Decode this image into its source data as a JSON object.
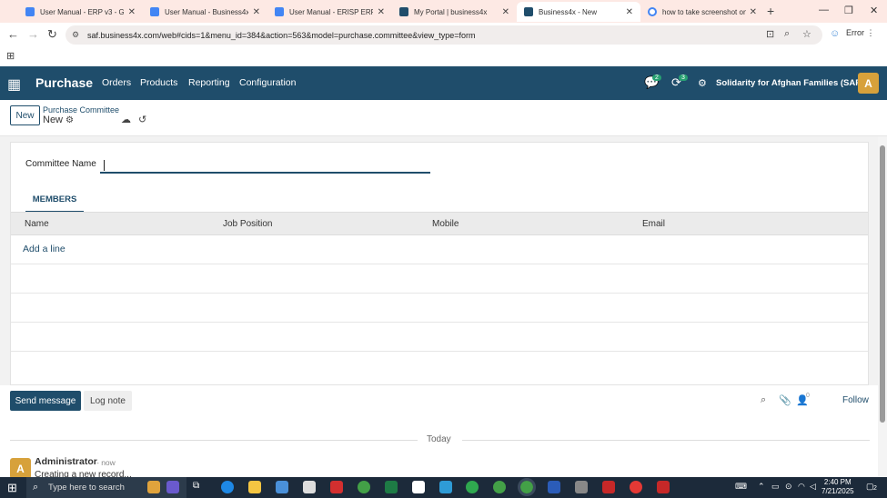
{
  "browser": {
    "tabs": [
      {
        "title": "User Manual - ERP v3 - Goo",
        "fav_color": "#4285f4",
        "active": false
      },
      {
        "title": "User Manual - Business4x v3",
        "fav_color": "#4285f4",
        "active": false
      },
      {
        "title": "User Manual - ERISP ERP v2",
        "fav_color": "#4285f4",
        "active": false
      },
      {
        "title": "My Portal | business4x",
        "fav_color": "#1f4d6b",
        "active": false
      },
      {
        "title": "Business4x - New",
        "fav_color": "#1f4d6b",
        "active": true
      },
      {
        "title": "how to take screenshot on la",
        "fav_color": "#4285f4",
        "active": false
      }
    ],
    "url": "saf.business4x.com/web#cids=1&menu_id=384&action=563&model=purchase.committee&view_type=form",
    "profile_label": "Error"
  },
  "app": {
    "brand": "Purchase",
    "menu": [
      "Orders",
      "Products",
      "Reporting",
      "Configuration"
    ],
    "chat_count": "2",
    "activity_count": "3",
    "company": "Solidarity for Afghan Families (SAF)",
    "avatar_letter": "A",
    "accent": "#1f4d6b"
  },
  "control": {
    "new_label": "New",
    "breadcrumb_parent": "Purchase Committee",
    "breadcrumb_current": "New"
  },
  "form": {
    "committee_name_label": "Committee Name",
    "committee_name_value": "",
    "tab_members": "MEMBERS",
    "columns": [
      "Name",
      "Job Position",
      "Mobile",
      "Email"
    ],
    "add_line": "Add a line"
  },
  "chatter": {
    "send_message": "Send message",
    "log_note": "Log note",
    "follower_count": "0",
    "follow": "Follow",
    "today": "Today",
    "author": "Administrator",
    "time": "- now",
    "avatar_letter": "A",
    "message": "Creating a new record..."
  },
  "taskbar": {
    "search_placeholder": "Type here to search",
    "time": "2:40 PM",
    "date": "7/21/2025",
    "notification_count": "2"
  }
}
